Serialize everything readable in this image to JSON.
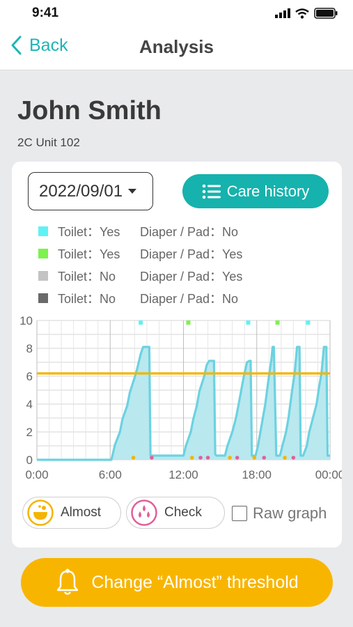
{
  "status_bar": {
    "time": "9:41"
  },
  "nav": {
    "back_label": "Back",
    "title": "Analysis"
  },
  "patient": {
    "name": "John Smith",
    "unit": "2C Unit 102"
  },
  "controls": {
    "date": "2022/09/01",
    "care_history_label": "Care history"
  },
  "legend": [
    {
      "toilet": "Toilet：Yes",
      "diaper": "Diaper / Pad：No",
      "color": "#5ff2f5"
    },
    {
      "toilet": "Toilet：Yes",
      "diaper": "Diaper / Pad：Yes",
      "color": "#7ef24d"
    },
    {
      "toilet": "Toilet：No",
      "diaper": "Diaper / Pad：Yes",
      "color": "#c3c3c3"
    },
    {
      "toilet": "Toilet：No",
      "diaper": "Diaper / Pad：No",
      "color": "#6a6a6a"
    }
  ],
  "chart_data": {
    "type": "area",
    "x_unit": "hours",
    "x_ticks": [
      "0:00",
      "6:00",
      "12:00",
      "18:00",
      "00:00"
    ],
    "x_tick_values": [
      0,
      6,
      12,
      18,
      24
    ],
    "y_ticks": [
      0,
      2,
      4,
      6,
      8,
      10
    ],
    "ylim": [
      0,
      10
    ],
    "xlim": [
      0,
      24
    ],
    "threshold": 6.2,
    "threshold_color": "#f4b400",
    "series_color": "#6cd2e0",
    "fill_color": "#b9e8ef",
    "grid": true,
    "series": [
      {
        "x": [
          0,
          6.0,
          6.1,
          6.4,
          6.8,
          7.0,
          7.4,
          7.6,
          8.0,
          8.2,
          8.5,
          8.7,
          8.9,
          9.0,
          9.2,
          9.3,
          9.4,
          11.8,
          12.0,
          12.2,
          12.6,
          12.8,
          13.1,
          13.3,
          13.7,
          13.9,
          14.1,
          14.3,
          14.5,
          14.6,
          14.7,
          15.4,
          15.6,
          16.0,
          16.3,
          16.5,
          16.9,
          17.2,
          17.4,
          17.5,
          17.6,
          17.9,
          18.1,
          18.3,
          18.5,
          18.7,
          19.0,
          19.2,
          19.3,
          19.4,
          19.6,
          19.9,
          20.1,
          20.4,
          20.6,
          20.9,
          21.1,
          21.3,
          21.4,
          21.5,
          21.6,
          21.8,
          22.1,
          22.3,
          22.6,
          22.9,
          23.1,
          23.3,
          23.5,
          23.7,
          23.8,
          24.0
        ],
        "y": [
          0,
          0,
          0,
          1.1,
          2.0,
          2.9,
          3.9,
          4.8,
          5.9,
          6.5,
          7.6,
          8.1,
          8.1,
          8.1,
          8.1,
          0.3,
          0.3,
          0.3,
          0.3,
          1.0,
          2.0,
          2.9,
          3.9,
          4.9,
          6.0,
          6.8,
          7.1,
          7.1,
          7.1,
          0.4,
          0.3,
          0.3,
          1.0,
          2.0,
          3.0,
          3.9,
          5.8,
          7.0,
          7.1,
          7.1,
          0.3,
          0.3,
          1.0,
          2.0,
          3.0,
          4.0,
          6.0,
          7.2,
          8.1,
          8.1,
          0.3,
          0.3,
          1.0,
          2.0,
          3.0,
          5.0,
          6.2,
          8.1,
          8.1,
          8.1,
          0.3,
          0.3,
          1.0,
          2.0,
          3.0,
          4.0,
          5.2,
          6.2,
          8.1,
          8.1,
          0.3,
          0.3
        ]
      }
    ],
    "top_markers": [
      {
        "x": 8.5,
        "color": "#5ff2f5"
      },
      {
        "x": 12.4,
        "color": "#7ef24d"
      },
      {
        "x": 17.3,
        "color": "#5ff2f5"
      },
      {
        "x": 19.7,
        "color": "#7ef24d"
      },
      {
        "x": 22.2,
        "color": "#5ff2f5"
      }
    ],
    "bottom_markers": [
      {
        "x": 7.9,
        "color": "#f4b400"
      },
      {
        "x": 9.4,
        "color": "#e0609a"
      },
      {
        "x": 12.7,
        "color": "#f4b400"
      },
      {
        "x": 13.4,
        "color": "#e0609a"
      },
      {
        "x": 14.0,
        "color": "#e0609a"
      },
      {
        "x": 15.8,
        "color": "#f4b400"
      },
      {
        "x": 16.4,
        "color": "#e0609a"
      },
      {
        "x": 17.8,
        "color": "#f4b400"
      },
      {
        "x": 18.6,
        "color": "#e0609a"
      },
      {
        "x": 20.3,
        "color": "#f4b400"
      },
      {
        "x": 21.0,
        "color": "#e0609a"
      }
    ]
  },
  "toggles": {
    "almost_label": "Almost",
    "check_label": "Check",
    "raw_graph_label": "Raw graph"
  },
  "threshold_button": {
    "label": "Change “Almost” threshold"
  }
}
